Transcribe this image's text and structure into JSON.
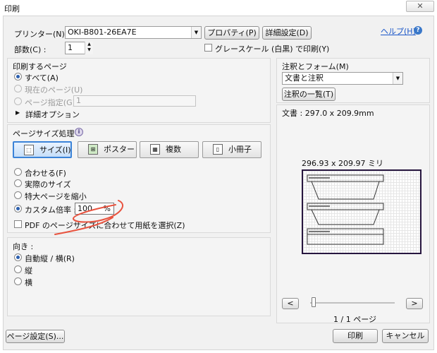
{
  "window": {
    "title": "印刷",
    "close_label": "✕"
  },
  "printer": {
    "label": "プリンター(N) :",
    "selected": "OKI-B801-26EA7E",
    "properties_button": "プロパティ(P)",
    "advanced_button": "詳細設定(D)",
    "help_link": "ヘルプ(H)"
  },
  "copies": {
    "label": "部数(C) :",
    "value": "1",
    "grayscale_label": "グレースケール (白黒) で印刷(Y)",
    "grayscale_checked": false
  },
  "pages": {
    "title": "印刷するページ",
    "all_label": "すべて(A)",
    "current_label": "現在のページ(U)",
    "range_label": "ページ指定(G)",
    "range_value": "1",
    "more_options_label": "詳細オプション",
    "selected": "all"
  },
  "sizing": {
    "title": "ページサイズ処理",
    "buttons": [
      {
        "label": "サイズ(I)",
        "icon": "fit-size-icon",
        "active": true
      },
      {
        "label": "ポスター",
        "icon": "poster-icon",
        "active": false
      },
      {
        "label": "複数",
        "icon": "multiple-pages-icon",
        "active": false
      },
      {
        "label": "小冊子",
        "icon": "booklet-icon",
        "active": false
      }
    ],
    "fit_label": "合わせる(F)",
    "actual_label": "実際のサイズ",
    "shrink_label": "特大ページを縮小",
    "custom_label": "カスタム倍率 :",
    "custom_value": "100",
    "custom_unit": "%",
    "pdf_paper_label": "PDF のページサイズに合わせて用紙を選択(Z)",
    "pdf_paper_checked": false,
    "selected": "custom"
  },
  "orientation": {
    "title": "向き :",
    "auto_label": "自動縦 / 横(R)",
    "portrait_label": "縦",
    "landscape_label": "横",
    "selected": "auto"
  },
  "comments": {
    "title": "注釈とフォーム(M)",
    "selected": "文書と注釈",
    "summary_button": "注釈の一覧(T)"
  },
  "preview": {
    "doc_size": "文書 : 297.0 x 209.9mm",
    "paper_size": "296.93 x 209.97 ミリ",
    "prev_label": "<",
    "next_label": ">",
    "page_indicator": "1 / 1 ページ"
  },
  "footer": {
    "page_setup_button": "ページ設定(S)...",
    "print_button": "印刷",
    "cancel_button": "キャンセル"
  },
  "colors": {
    "accent_blue": "#3b83d8",
    "annotation_red": "#e8533f",
    "preview_border": "#27163f"
  }
}
